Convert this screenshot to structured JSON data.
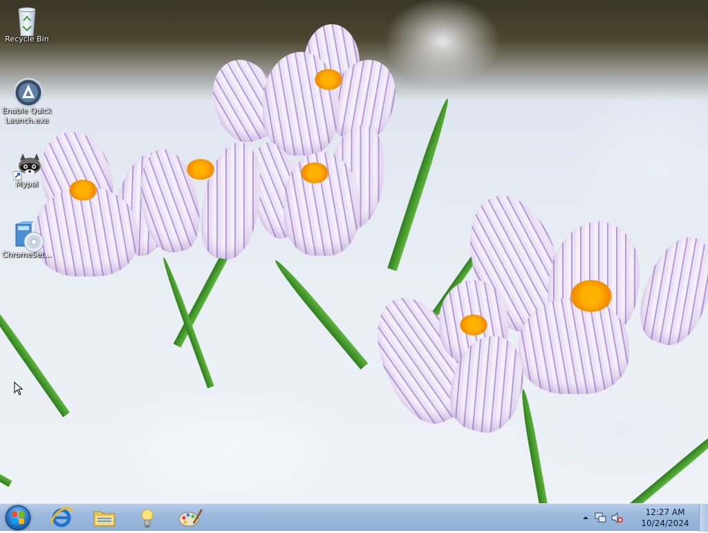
{
  "desktop": {
    "wallpaper": "purple crocus flowers in snow",
    "icons": [
      {
        "label": "Recycle Bin",
        "icon": "recycle-bin-icon"
      },
      {
        "label": "Enable Quick Launch.exe",
        "icon": "quick-launch-app-icon"
      },
      {
        "label": "Mypal",
        "icon": "mypal-raccoon-icon"
      },
      {
        "label": "ChromeSet...",
        "icon": "chrome-setup-installer-icon"
      }
    ]
  },
  "taskbar": {
    "start_button": "start-orb",
    "pinned": [
      {
        "name": "Internet Explorer",
        "icon": "internet-explorer-icon"
      },
      {
        "name": "Windows Explorer",
        "icon": "folder-explorer-icon"
      },
      {
        "name": "Tips",
        "icon": "lightbulb-icon"
      },
      {
        "name": "Paint",
        "icon": "paint-palette-icon"
      }
    ],
    "tray": {
      "time": "12:27 AM",
      "date": "10/24/2024",
      "icons": [
        "show-hidden-icons-arrow",
        "network-icon",
        "volume-muted-icon"
      ]
    }
  },
  "colors": {
    "taskbar": "#9db9dd",
    "accent": "#2a7fd0",
    "flower": "#b79ad6",
    "stamen": "#f08a00"
  }
}
